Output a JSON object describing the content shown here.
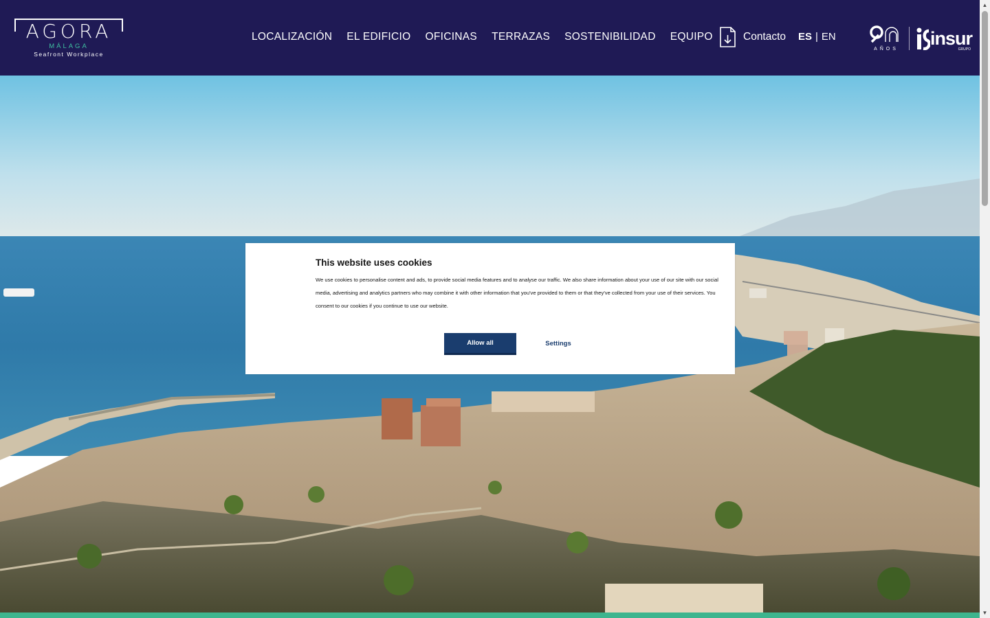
{
  "brand": {
    "logo_word": "AGORA",
    "logo_city": "MÁLAGA",
    "logo_tagline": "Seafront Workplace",
    "anniversary_label": "AÑOS",
    "group_name": "insur",
    "group_tag": "GRUPO"
  },
  "nav": {
    "items": [
      "LOCALIZACIÓN",
      "EL EDIFICIO",
      "OFICINAS",
      "TERRAZAS",
      "SOSTENIBILIDAD",
      "EQUIPO"
    ],
    "contact_label": "Contacto",
    "contact_icon": "download-icon"
  },
  "lang": {
    "es": "ES",
    "sep": "|",
    "en": "EN",
    "active": "ES"
  },
  "cookie": {
    "title": "This website uses cookies",
    "body": "We use cookies to personalise content and ads, to provide social media features and to analyse our traffic. We also share information about your use of our site with our social media, advertising and analytics partners who may combine it with other information that you've provided to them or that they've collected from your use of their services. You consent to our cookies if you continue to use our website.",
    "allow_label": "Allow all",
    "settings_label": "Settings"
  },
  "colors": {
    "header_bg": "#1f1a55",
    "accent_green": "#3db58e",
    "button_blue": "#1a3d6e"
  }
}
